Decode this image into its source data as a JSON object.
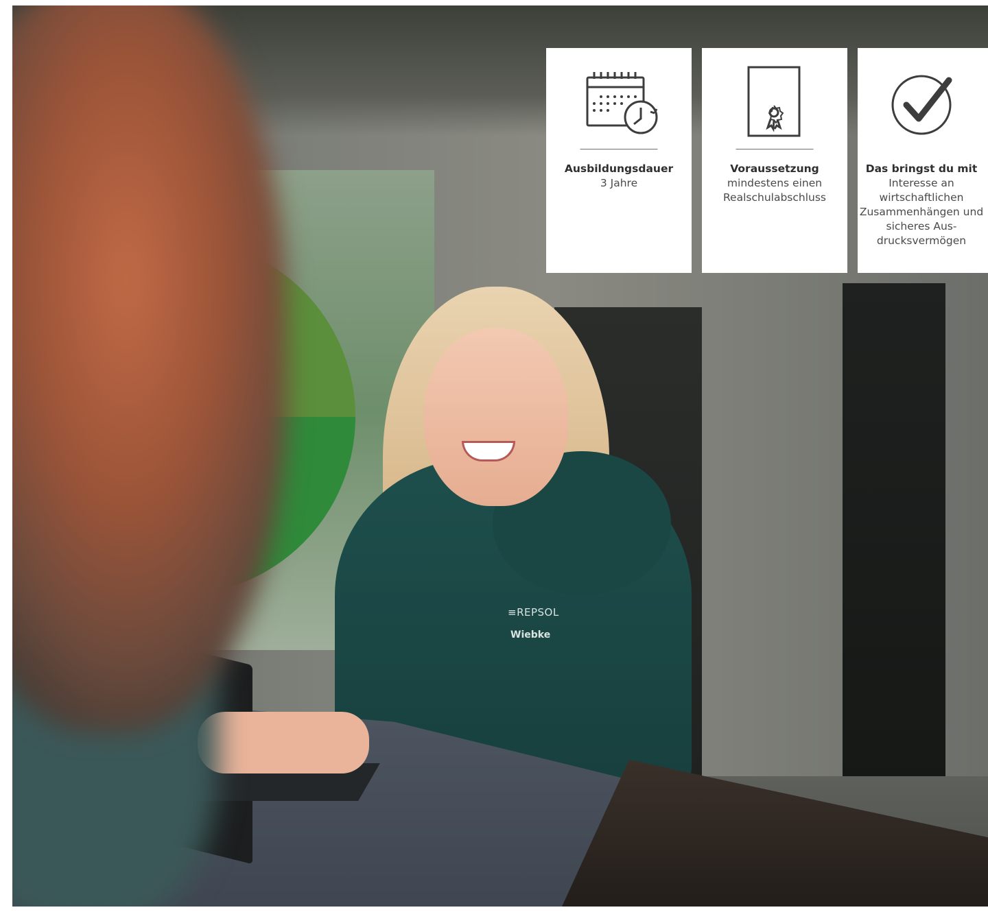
{
  "hero": {
    "hoodie_logo": "≡REPSOL",
    "hoodie_name": "Wiebke"
  },
  "cards": [
    {
      "icon": "calendar-clock-icon",
      "title": "Ausbildungsdauer",
      "body": "3 Jahre"
    },
    {
      "icon": "certificate-icon",
      "title": "Voraussetzung",
      "body": "mindestens einen Realschulabschluss"
    },
    {
      "icon": "checkmark-circle-icon",
      "title": "Das bringst du mit",
      "body": "Interesse an wirtschaftlichen Zusammenhängen und sicheres Aus-drucksvermögen"
    }
  ],
  "colors": {
    "card_background": "#ffffff",
    "icon_stroke": "#3d3d3d",
    "hoodie": "#1e4f4c"
  }
}
